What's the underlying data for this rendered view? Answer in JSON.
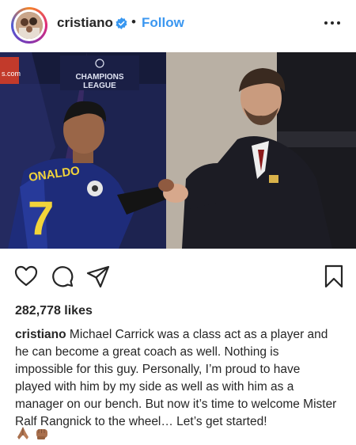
{
  "post": {
    "username": "cristiano",
    "separator": "•",
    "follow_label": "Follow",
    "photo_text": {
      "league_line1": "CHAMPIONS",
      "league_line2": "LEAGUE",
      "sponsor_fragment": "s.com",
      "jersey_name": "ONALDO",
      "jersey_number": "7"
    },
    "likes": "282,778 likes",
    "caption_username": "cristiano",
    "caption_text": "Michael Carrick was a class act as a player and he can become a great coach as well. Nothing is impossible for this guy. Personally, I’m proud to have played with him by my side as well as with him as a manager on our bench. But now it’s time to welcome Mister Ralf Rangnick to the wheel… Let’s get started!",
    "emojis": [
      "folded-hands-emoji",
      "fist-emoji"
    ]
  },
  "colors": {
    "follow": "#3b97f0",
    "verified": "#3897f0",
    "text": "#262626"
  },
  "icons": [
    "verified-badge-icon",
    "more-options-icon",
    "heart-icon",
    "comment-icon",
    "share-icon",
    "bookmark-icon"
  ]
}
